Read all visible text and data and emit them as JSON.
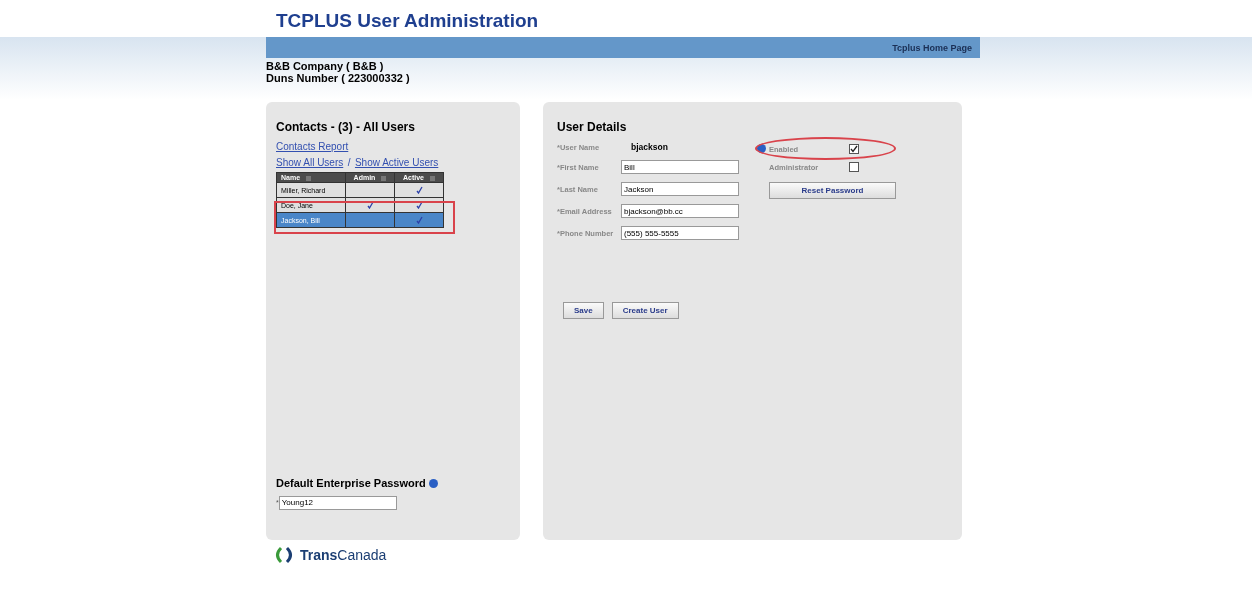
{
  "title": "TCPLUS User Administration",
  "header": {
    "home_link": "Tcplus Home Page",
    "company": "B&B Company ( B&B )",
    "duns": "Duns Number ( 223000332 )"
  },
  "contacts": {
    "title": "Contacts - (3) - All Users",
    "report_link": "Contacts Report",
    "show_all": "Show All Users",
    "separator": "/",
    "show_active": "Show Active Users",
    "columns": [
      "Name",
      "Admin",
      "Active"
    ],
    "rows": [
      {
        "name": "Miller, Richard",
        "admin": false,
        "active": true,
        "selected": false
      },
      {
        "name": "Doe, Jane",
        "admin": true,
        "active": true,
        "selected": false
      },
      {
        "name": "Jackson, Bill",
        "admin": false,
        "active": true,
        "selected": true
      }
    ],
    "default_password_label": "Default Enterprise Password",
    "required_mark": "*",
    "default_password": "Young12"
  },
  "details": {
    "title": "User Details",
    "user_name_label": "*User Name",
    "user_name": "bjackson",
    "fields": [
      {
        "label": "*First Name",
        "value": "Bill"
      },
      {
        "label": "*Last Name",
        "value": "Jackson"
      },
      {
        "label": "*Email Address",
        "value": "bjackson@bb.cc"
      },
      {
        "label": "*Phone Number",
        "value": "(555) 555-5555"
      }
    ],
    "options": [
      {
        "label": "Enabled",
        "checked": true
      },
      {
        "label": "Administrator",
        "checked": false
      }
    ],
    "reset_button": "Reset Password",
    "buttons": [
      "Save",
      "Create User"
    ]
  },
  "logo": "**Trans**Canada"
}
